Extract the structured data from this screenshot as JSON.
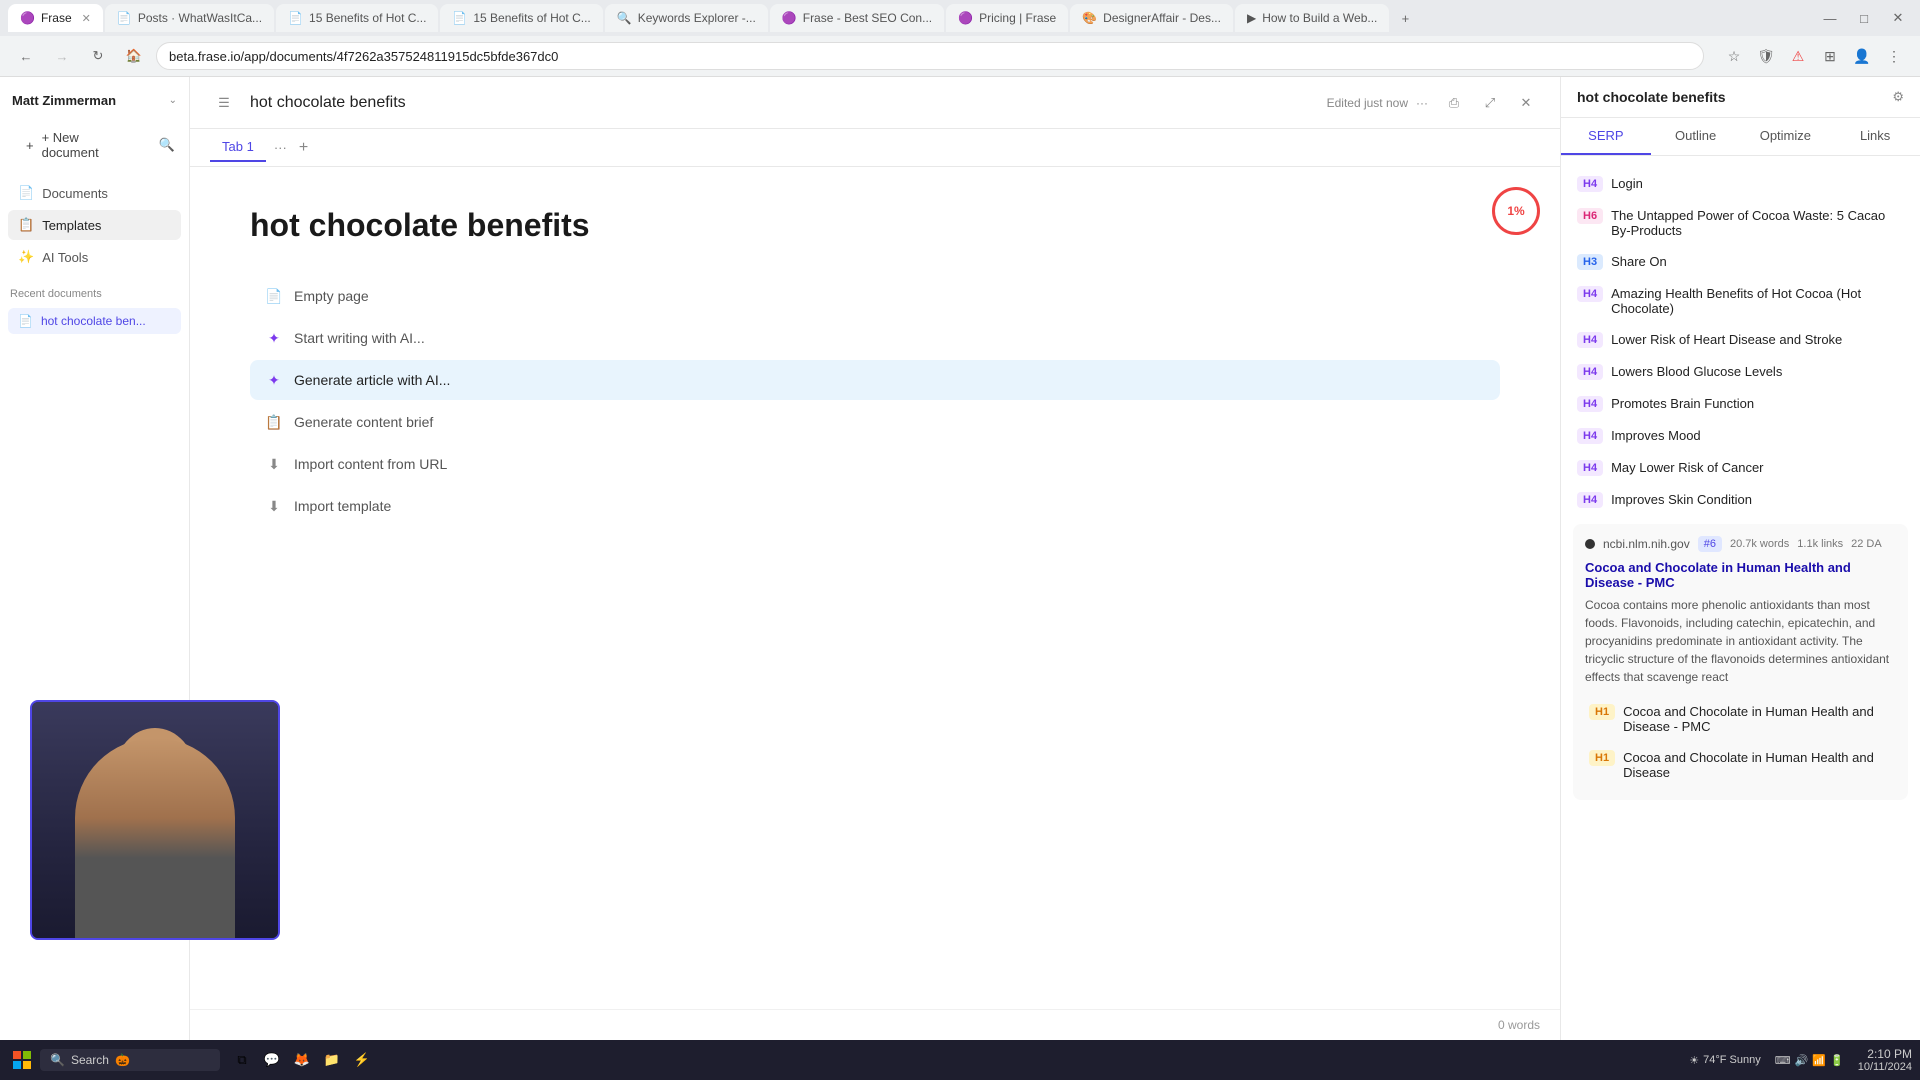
{
  "browser": {
    "tabs": [
      {
        "id": "frase",
        "label": "Frase",
        "favicon": "🟣",
        "active": true
      },
      {
        "id": "whatwasit",
        "label": "Posts · WhatWasItCa...",
        "favicon": "📄",
        "active": false
      },
      {
        "id": "15benefits1",
        "label": "15 Benefits of Hot C...",
        "favicon": "📄",
        "active": false
      },
      {
        "id": "15benefits2",
        "label": "15 Benefits of Hot C...",
        "favicon": "📄",
        "active": false
      },
      {
        "id": "keywords",
        "label": "Keywords Explorer -...",
        "favicon": "🔍",
        "active": false
      },
      {
        "id": "frase-seo",
        "label": "Frase - Best SEO Con...",
        "favicon": "🟣",
        "active": false
      },
      {
        "id": "pricing",
        "label": "Pricing | Frase",
        "favicon": "🟣",
        "active": false
      },
      {
        "id": "designer",
        "label": "DesignerAffair - Des...",
        "favicon": "🎨",
        "active": false
      },
      {
        "id": "youtube",
        "label": "How to Build a Web...",
        "favicon": "▶",
        "active": false
      }
    ],
    "address": "beta.frase.io/app/documents/4f7262a357524811915dc5bfde367dc0"
  },
  "sidebar": {
    "user": "Matt Zimmerman",
    "new_doc_label": "+ New document",
    "search_placeholder": "Search",
    "nav_items": [
      {
        "id": "documents",
        "label": "Documents",
        "icon": "📄"
      },
      {
        "id": "templates",
        "label": "Templates",
        "icon": "📋"
      },
      {
        "id": "ai-tools",
        "label": "AI Tools",
        "icon": "✨"
      }
    ],
    "recent_section": "Recent documents",
    "recent_items": [
      {
        "id": "hot-choc",
        "label": "hot chocolate ben...",
        "active": true
      }
    ]
  },
  "doc": {
    "title": "hot chocolate benefits",
    "edited": "Edited just now",
    "tabs": [
      {
        "id": "tab1",
        "label": "Tab 1",
        "active": true
      }
    ],
    "heading": "hot chocolate benefits",
    "actions": [
      {
        "id": "empty-page",
        "label": "Empty page",
        "icon": "📄",
        "ai": false
      },
      {
        "id": "start-ai",
        "label": "Start writing with AI...",
        "icon": "✦",
        "ai": true
      },
      {
        "id": "generate-article",
        "label": "Generate article with AI...",
        "icon": "✦",
        "ai": true,
        "highlighted": true
      },
      {
        "id": "generate-brief",
        "label": "Generate content brief",
        "icon": "📋",
        "ai": false
      },
      {
        "id": "import-url",
        "label": "Import content from URL",
        "icon": "⬇",
        "ai": false
      },
      {
        "id": "import-template",
        "label": "Import template",
        "icon": "⬇",
        "ai": false
      }
    ],
    "progress": "1%",
    "word_count": "0 words"
  },
  "panel": {
    "title": "hot chocolate benefits",
    "tabs": [
      "SERP",
      "Outline",
      "Optimize",
      "Links"
    ],
    "active_tab": "SERP",
    "serp_headings": [
      {
        "tag": "H4",
        "tag_class": "h4-tag",
        "text": "Login"
      },
      {
        "tag": "H6",
        "tag_class": "h6-tag",
        "text": "The Untapped Power of Cocoa Waste: 5 Cacao By-Products"
      },
      {
        "tag": "H3",
        "tag_class": "h3-tag",
        "text": "Share On"
      },
      {
        "tag": "H4",
        "tag_class": "h4-tag",
        "text": "Amazing Health Benefits of Hot Cocoa (Hot Chocolate)"
      },
      {
        "tag": "H4",
        "tag_class": "h4-tag",
        "text": "Lower Risk of Heart Disease and Stroke"
      },
      {
        "tag": "H4",
        "tag_class": "h4-tag",
        "text": "Lowers Blood Glucose Levels"
      },
      {
        "tag": "H4",
        "tag_class": "h4-tag",
        "text": "Promotes Brain Function"
      },
      {
        "tag": "H4",
        "tag_class": "h4-tag",
        "text": "Improves Mood"
      },
      {
        "tag": "H4",
        "tag_class": "h4-tag",
        "text": "May Lower Risk of Cancer"
      },
      {
        "tag": "H4",
        "tag_class": "h4-tag",
        "text": "Improves Skin Condition"
      }
    ],
    "serp_result": {
      "domain": "ncbi.nlm.nih.gov",
      "badge": "#6",
      "words": "20.7k words",
      "links": "1.1k links",
      "da": "22 DA",
      "title": "Cocoa and Chocolate in Human Health and Disease - PMC",
      "snippet": "Cocoa contains more phenolic antioxidants than most foods. Flavonoids, including catechin, epicatechin, and procyanidins predominate in antioxidant activity. The tricyclic structure of the flavonoids determines antioxidant effects that scavenge react",
      "h1_items": [
        "Cocoa and Chocolate in Human Health and Disease - PMC",
        "Cocoa and Chocolate in Human Health and Disease"
      ]
    }
  },
  "taskbar": {
    "search_label": "Search",
    "weather": "74°F Sunny",
    "time": "2:10 PM",
    "date": "10/11/2024"
  }
}
